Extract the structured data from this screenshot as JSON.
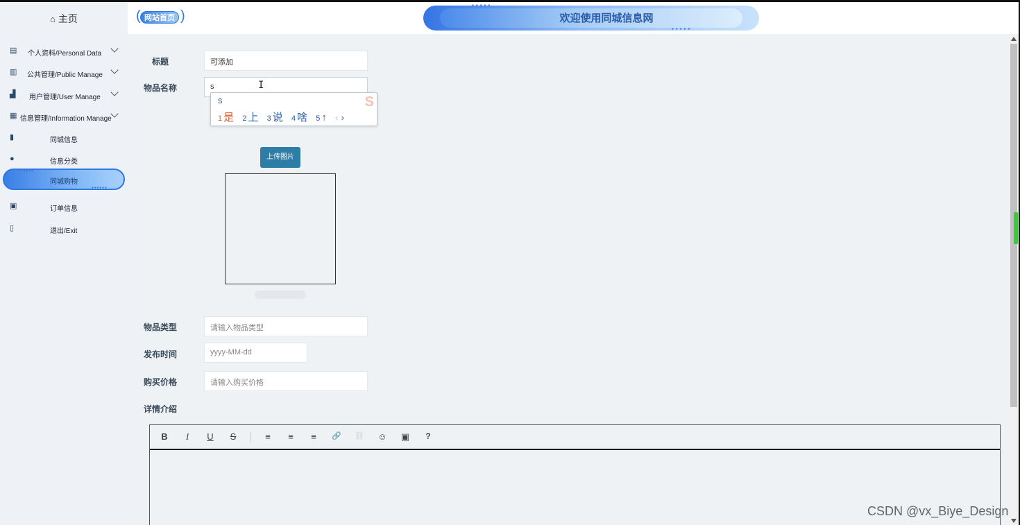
{
  "sidebar": {
    "home_label": "主页",
    "home_icon": "home-icon",
    "items": [
      {
        "label": "个人资料/Personal Data",
        "icon": "profile-icon"
      },
      {
        "label": "公共管理/Public Manage",
        "icon": "clipboard-icon"
      },
      {
        "label": "用户管理/User Manage",
        "icon": "users-icon"
      },
      {
        "label": "信息管理/Information Manage",
        "icon": "chart-icon"
      }
    ],
    "sub_items": [
      {
        "label": "同城信息",
        "icon": "bookmark-icon"
      },
      {
        "label": "信息分类",
        "icon": "person-icon"
      },
      {
        "label": "同城购物",
        "active": true
      }
    ],
    "bottom_items": [
      {
        "label": "订单信息",
        "icon": "calendar-check-icon"
      },
      {
        "label": "退出/Exit",
        "icon": "book-icon"
      }
    ]
  },
  "header": {
    "site_home_label": "网站首页",
    "banner_title": "欢迎使用同城信息网"
  },
  "form": {
    "title_label": "标题",
    "title_value": "可添加",
    "name_label": "物品名称",
    "name_value": "s",
    "upload_label": "上传图片",
    "type_label": "物品类型",
    "type_placeholder": "请输入物品类型",
    "time_label": "发布时间",
    "time_placeholder": "yyyy-MM-dd",
    "price_label": "购买价格",
    "price_placeholder": "请输入购买价格",
    "detail_label": "详情介绍"
  },
  "ime": {
    "typed": "s",
    "candidates": [
      {
        "num": "1",
        "text": "是"
      },
      {
        "num": "2",
        "text": "上"
      },
      {
        "num": "3",
        "text": "说"
      },
      {
        "num": "4",
        "text": "啥"
      },
      {
        "num": "5",
        "text": "↑"
      }
    ],
    "prev": "‹",
    "next": "›"
  },
  "editor": {
    "toolbar": [
      "B",
      "I",
      "U",
      "S",
      "≡",
      "≡",
      "≡",
      "🔗",
      "⛓",
      "☺",
      "▣",
      "?"
    ]
  },
  "watermark": "CSDN @vx_Biye_Design",
  "colors": {
    "accent": "#2f78e0",
    "upload_button": "#2d7da6",
    "ime_selected": "#e05a2a"
  }
}
